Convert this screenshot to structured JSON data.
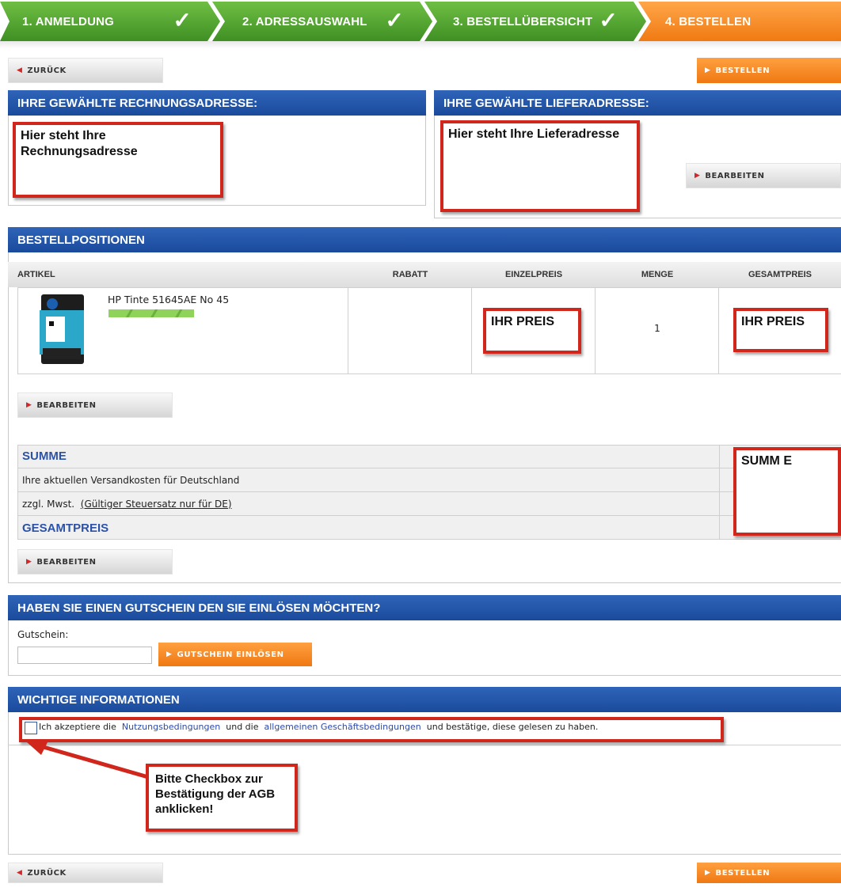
{
  "steps": [
    {
      "label": "1. ANMELDUNG",
      "done": true
    },
    {
      "label": "2. ADRESSAUSWAHL",
      "done": true
    },
    {
      "label": "3. BESTELLÜBERSICHT",
      "done": true
    },
    {
      "label": "4. BESTELLEN",
      "done": false
    }
  ],
  "check_glyph": "✓",
  "nav": {
    "back_label": "ZURÜCK",
    "order_label": "BESTELLEN"
  },
  "billing": {
    "header": "IHRE GEWÄHLTE RECHNUNGSADRESSE:",
    "note": "Hier steht Ihre Rechnungsadresse"
  },
  "shipping": {
    "header": "IHRE GEWÄHLTE LIEFERADRESSE:",
    "note": "Hier steht Ihre Lieferadresse",
    "edit_label": "BEARBEITEN"
  },
  "positions": {
    "header": "BESTELLPOSITIONEN",
    "columns": [
      "ARTIKEL",
      "RABATT",
      "EINZELPREIS",
      "MENGE",
      "GESAMTPREIS"
    ],
    "item": {
      "name": "HP Tinte 51645AE No 45",
      "unit_price_note": "IHR PREIS",
      "quantity": "1",
      "total_price_note": "IHR PREIS"
    },
    "edit_label": "BEARBEITEN"
  },
  "summary": {
    "sum_label": "SUMME",
    "shipping_text": "Ihre aktuellen Versandkosten für Deutschland",
    "vat_prefix": "zzgl. Mwst.",
    "vat_link": "(Gültiger Steuersatz nur für DE)",
    "total_label": "GESAMTPREIS",
    "sum_note": "SUMM E",
    "edit_label": "BEARBEITEN"
  },
  "voucher": {
    "header": "HABEN SIE EINEN GUTSCHEIN DEN SIE EINLÖSEN MÖCHTEN?",
    "label": "Gutschein:",
    "value": "",
    "button_label": "GUTSCHEIN EINLÖSEN"
  },
  "info": {
    "header": "WICHTIGE INFORMATIONEN",
    "terms_prefix": "Ich akzeptiere die",
    "terms_link1": "Nutzungsbedingungen",
    "terms_mid": "und die",
    "terms_link2": "allgemeinen Geschäftsbedingungen",
    "terms_suffix": "und bestätige, diese gelesen zu haben.",
    "terms_checked": false,
    "callout": "Bitte Checkbox zur Bestätigung der AGB anklicken!"
  },
  "colors": {
    "step_done": "#4fa22e",
    "step_active": "#f58220",
    "header_blue": "#1f4fa0",
    "annotation_red": "#d0261c"
  }
}
